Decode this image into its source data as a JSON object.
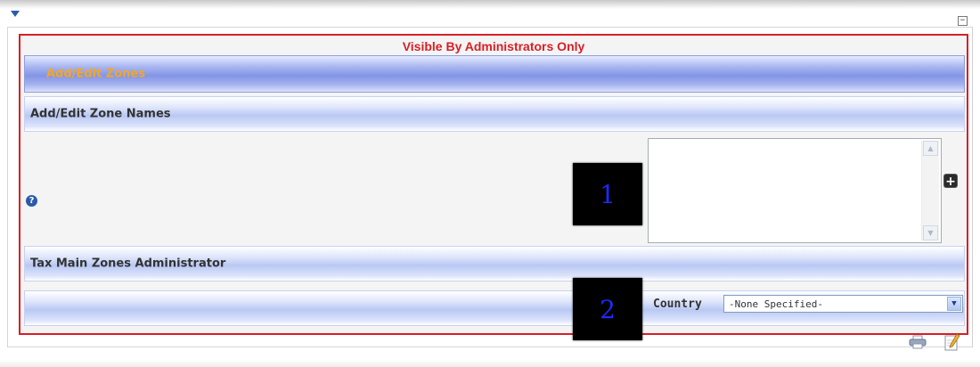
{
  "header": {
    "collapse_icon": "triangle-down-icon",
    "minimize_icon": "minus-box-icon",
    "minimize_glyph": "−"
  },
  "admin_section": {
    "visibility_note": "Visible By Administrators Only",
    "border_color": "#d81f26"
  },
  "bands": {
    "zones_title": "Add/Edit Zones",
    "zone_names_title": "Add/Edit Zone Names",
    "tax_admin_title": "Tax Main Zones Administrator"
  },
  "zone_names": {
    "help_icon": "question-mark-icon",
    "help_glyph": "?",
    "textarea_value": "",
    "add_icon": "plus-icon",
    "add_glyph": "+"
  },
  "markers": {
    "marker_1": "1",
    "marker_2": "2"
  },
  "country": {
    "label": "Country",
    "selected": "-None Specified-",
    "arrow_glyph": "▼"
  },
  "footer": {
    "print_icon": "printer-icon",
    "edit_icon": "pencil-edit-icon"
  },
  "colors": {
    "accent_orange": "#f5a623",
    "band_blue": "#8395e6",
    "marker_text": "#1a2cff"
  }
}
